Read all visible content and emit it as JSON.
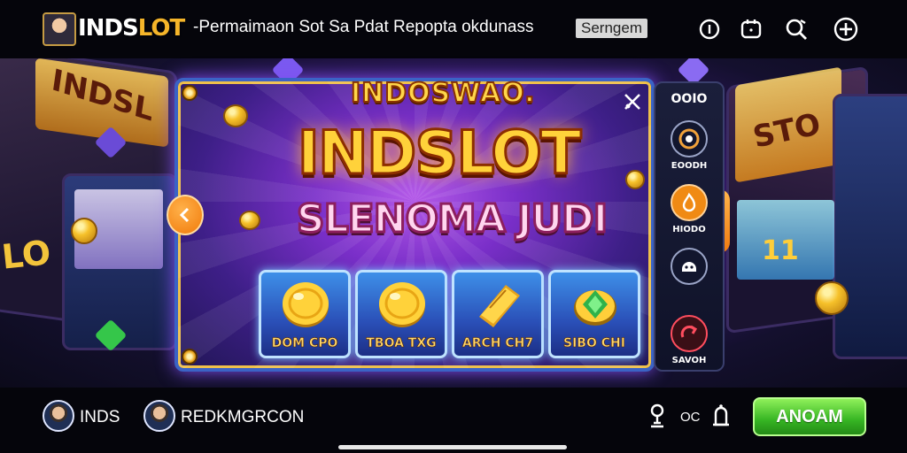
{
  "header": {
    "logo_main": "INDS",
    "logo_accent": "LOT",
    "tagline": "-Permaimaon Sot Sa Pdat Repopta okdunass",
    "badge": "Serngem",
    "icons": [
      "info-icon",
      "chat-icon",
      "search-icon",
      "add-icon"
    ]
  },
  "scene": {
    "left_cabinet_text": "INDSL",
    "left_cabinet_text2": "LO",
    "right_cabinet_text": "STO",
    "right_cabinet_text2": "11"
  },
  "panel": {
    "subtitle": "INDOSWAO.",
    "title": "INDSLOT",
    "headline": "SLENOMA JUDI",
    "prizes": [
      {
        "label": "DOM CPO",
        "icon": "gold-coin-icon"
      },
      {
        "label": "TBOA TXG",
        "icon": "gold-coin-icon"
      },
      {
        "label": "ARCH CH7",
        "icon": "golden-ticket-icon"
      },
      {
        "label": "SIBO CHI",
        "icon": "green-gem-icon"
      }
    ]
  },
  "sidebar": {
    "top_label": "OOIO",
    "items": [
      {
        "label": "EOODH",
        "icon": "wheel-icon"
      },
      {
        "label": "HIODO",
        "icon": "fire-icon"
      },
      {
        "label": "",
        "icon": "helmet-icon"
      },
      {
        "label": "SAVOH",
        "icon": "refresh-icon"
      }
    ]
  },
  "footer": {
    "user1": "INDS",
    "user2": "REDKMGRCON",
    "count": "OC",
    "cta_label": "ANOAM"
  },
  "colors": {
    "accent_gold": "#f5b52a",
    "cta_green": "#36b523",
    "panel_purple": "#7a2fc9",
    "nav_orange": "#f17a0a"
  }
}
